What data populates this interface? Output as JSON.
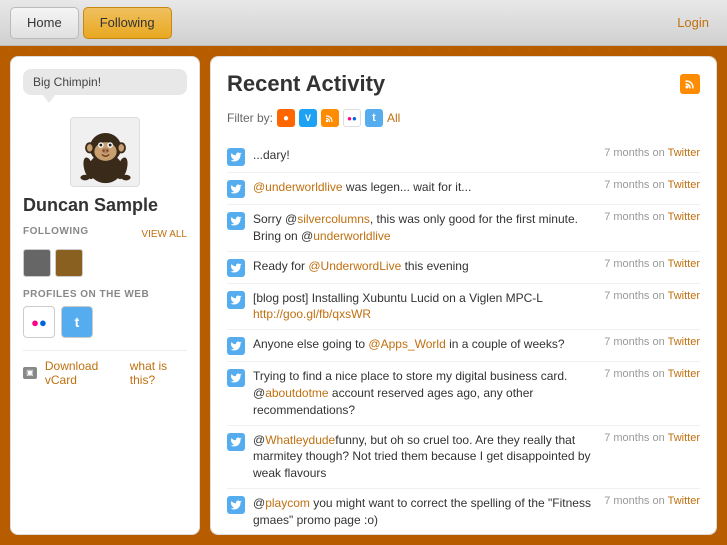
{
  "nav": {
    "home_label": "Home",
    "following_label": "Following",
    "login_label": "Login"
  },
  "sidebar": {
    "speech_bubble": "Big Chimpin!",
    "user_name": "Duncan Sample",
    "following_label": "FOLLOWING",
    "view_all_label": "VIEW ALL",
    "profiles_label": "PROFILES ON THE WEB",
    "download_vcard_label": "Download vCard",
    "what_is_this_label": "what is this?"
  },
  "content": {
    "title": "Recent Activity",
    "filter_label": "Filter by:",
    "filter_all_label": "All",
    "rss_icon_label": "rss",
    "activities": [
      {
        "service": "Twitter",
        "text": "...dary!",
        "meta": "7 months on",
        "meta_service": "Twitter",
        "has_link": false
      },
      {
        "service": "Twitter",
        "text": "@underworldlive was legen... wait for it...",
        "link_text": "@underworldlive",
        "meta": "7 months on",
        "meta_service": "Twitter",
        "has_link": true,
        "link_url": "#"
      },
      {
        "service": "Twitter",
        "text_before": "Sorry @",
        "link1_text": "silvercolumns",
        "text_after1": ", this was only good for the first minute. Bring on @",
        "link2_text": "underworldlive",
        "text_after2": "",
        "meta": "7 months on",
        "meta_service": "Twitter",
        "type": "multi-link"
      },
      {
        "service": "Twitter",
        "text": "Ready for @UnderwordLive this evening",
        "link_text": "@UnderwordLive",
        "meta": "7 months on",
        "meta_service": "Twitter",
        "has_link": true,
        "link_url": "#"
      },
      {
        "service": "Twitter",
        "text": "[blog post] Installing Xubuntu Lucid on a Viglen MPC-L",
        "link_text": "http://goo.gl/fb/qxsWR",
        "meta": "7 months on",
        "meta_service": "Twitter",
        "has_link": true,
        "link_url": "#"
      },
      {
        "service": "Twitter",
        "text": "Anyone else going to @Apps_World in a couple of weeks?",
        "link_text": "@Apps_World",
        "meta": "7 months on",
        "meta_service": "Twitter",
        "has_link": true,
        "link_url": "#"
      },
      {
        "service": "Twitter",
        "text_before": "Trying to find a nice place to store my digital business card. @",
        "link1_text": "aboutdotme",
        "text_after": " account reserved ages ago, any other recommendations?",
        "meta": "7 months on",
        "meta_service": "Twitter",
        "type": "single-link-inline"
      },
      {
        "service": "Twitter",
        "text_before": "@",
        "link1_text": "Whatleydude",
        "text_after": "funny, but oh so cruel too. Are they really that marmitey though? Not tried them because I get disappointed by weak flavours",
        "meta": "7 months on",
        "meta_service": "Twitter",
        "type": "single-link-inline"
      },
      {
        "service": "Twitter",
        "text_before": "@",
        "link1_text": "playcom",
        "text_after": " you might want to correct the spelling of the \"Fitness gmaes\" promo page :o)",
        "meta": "7 months on",
        "meta_service": "Twitter",
        "type": "single-link-inline"
      }
    ]
  }
}
